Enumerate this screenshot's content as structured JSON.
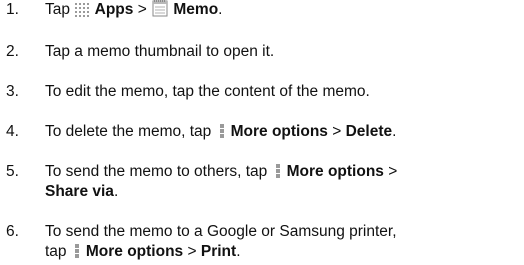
{
  "steps": [
    {
      "number": "1.",
      "parts": {
        "tap": "Tap",
        "apps": "Apps",
        "sep": ">",
        "memo": "Memo",
        "end": "."
      }
    },
    {
      "number": "2.",
      "text": "Tap a memo thumbnail to open it."
    },
    {
      "number": "3.",
      "text": "To edit the memo, tap the content of the memo."
    },
    {
      "number": "4.",
      "parts": {
        "lead": "To delete the memo, tap",
        "more": "More options",
        "sep": ">",
        "delete": "Delete",
        "end": "."
      }
    },
    {
      "number": "5.",
      "parts": {
        "lead": "To send the memo to others, tap",
        "more": "More options",
        "sep": ">",
        "share": "Share via",
        "end": "."
      }
    },
    {
      "number": "6.",
      "parts": {
        "lead": "To send the memo to a Google or Samsung printer,",
        "tap": "tap",
        "more": "More options",
        "sep": ">",
        "print": "Print",
        "end": "."
      }
    }
  ],
  "icons": {
    "apps": "apps-grid-icon",
    "memo": "memo-icon",
    "more": "more-options-icon",
    "icon_color": "#9a9a9a"
  }
}
